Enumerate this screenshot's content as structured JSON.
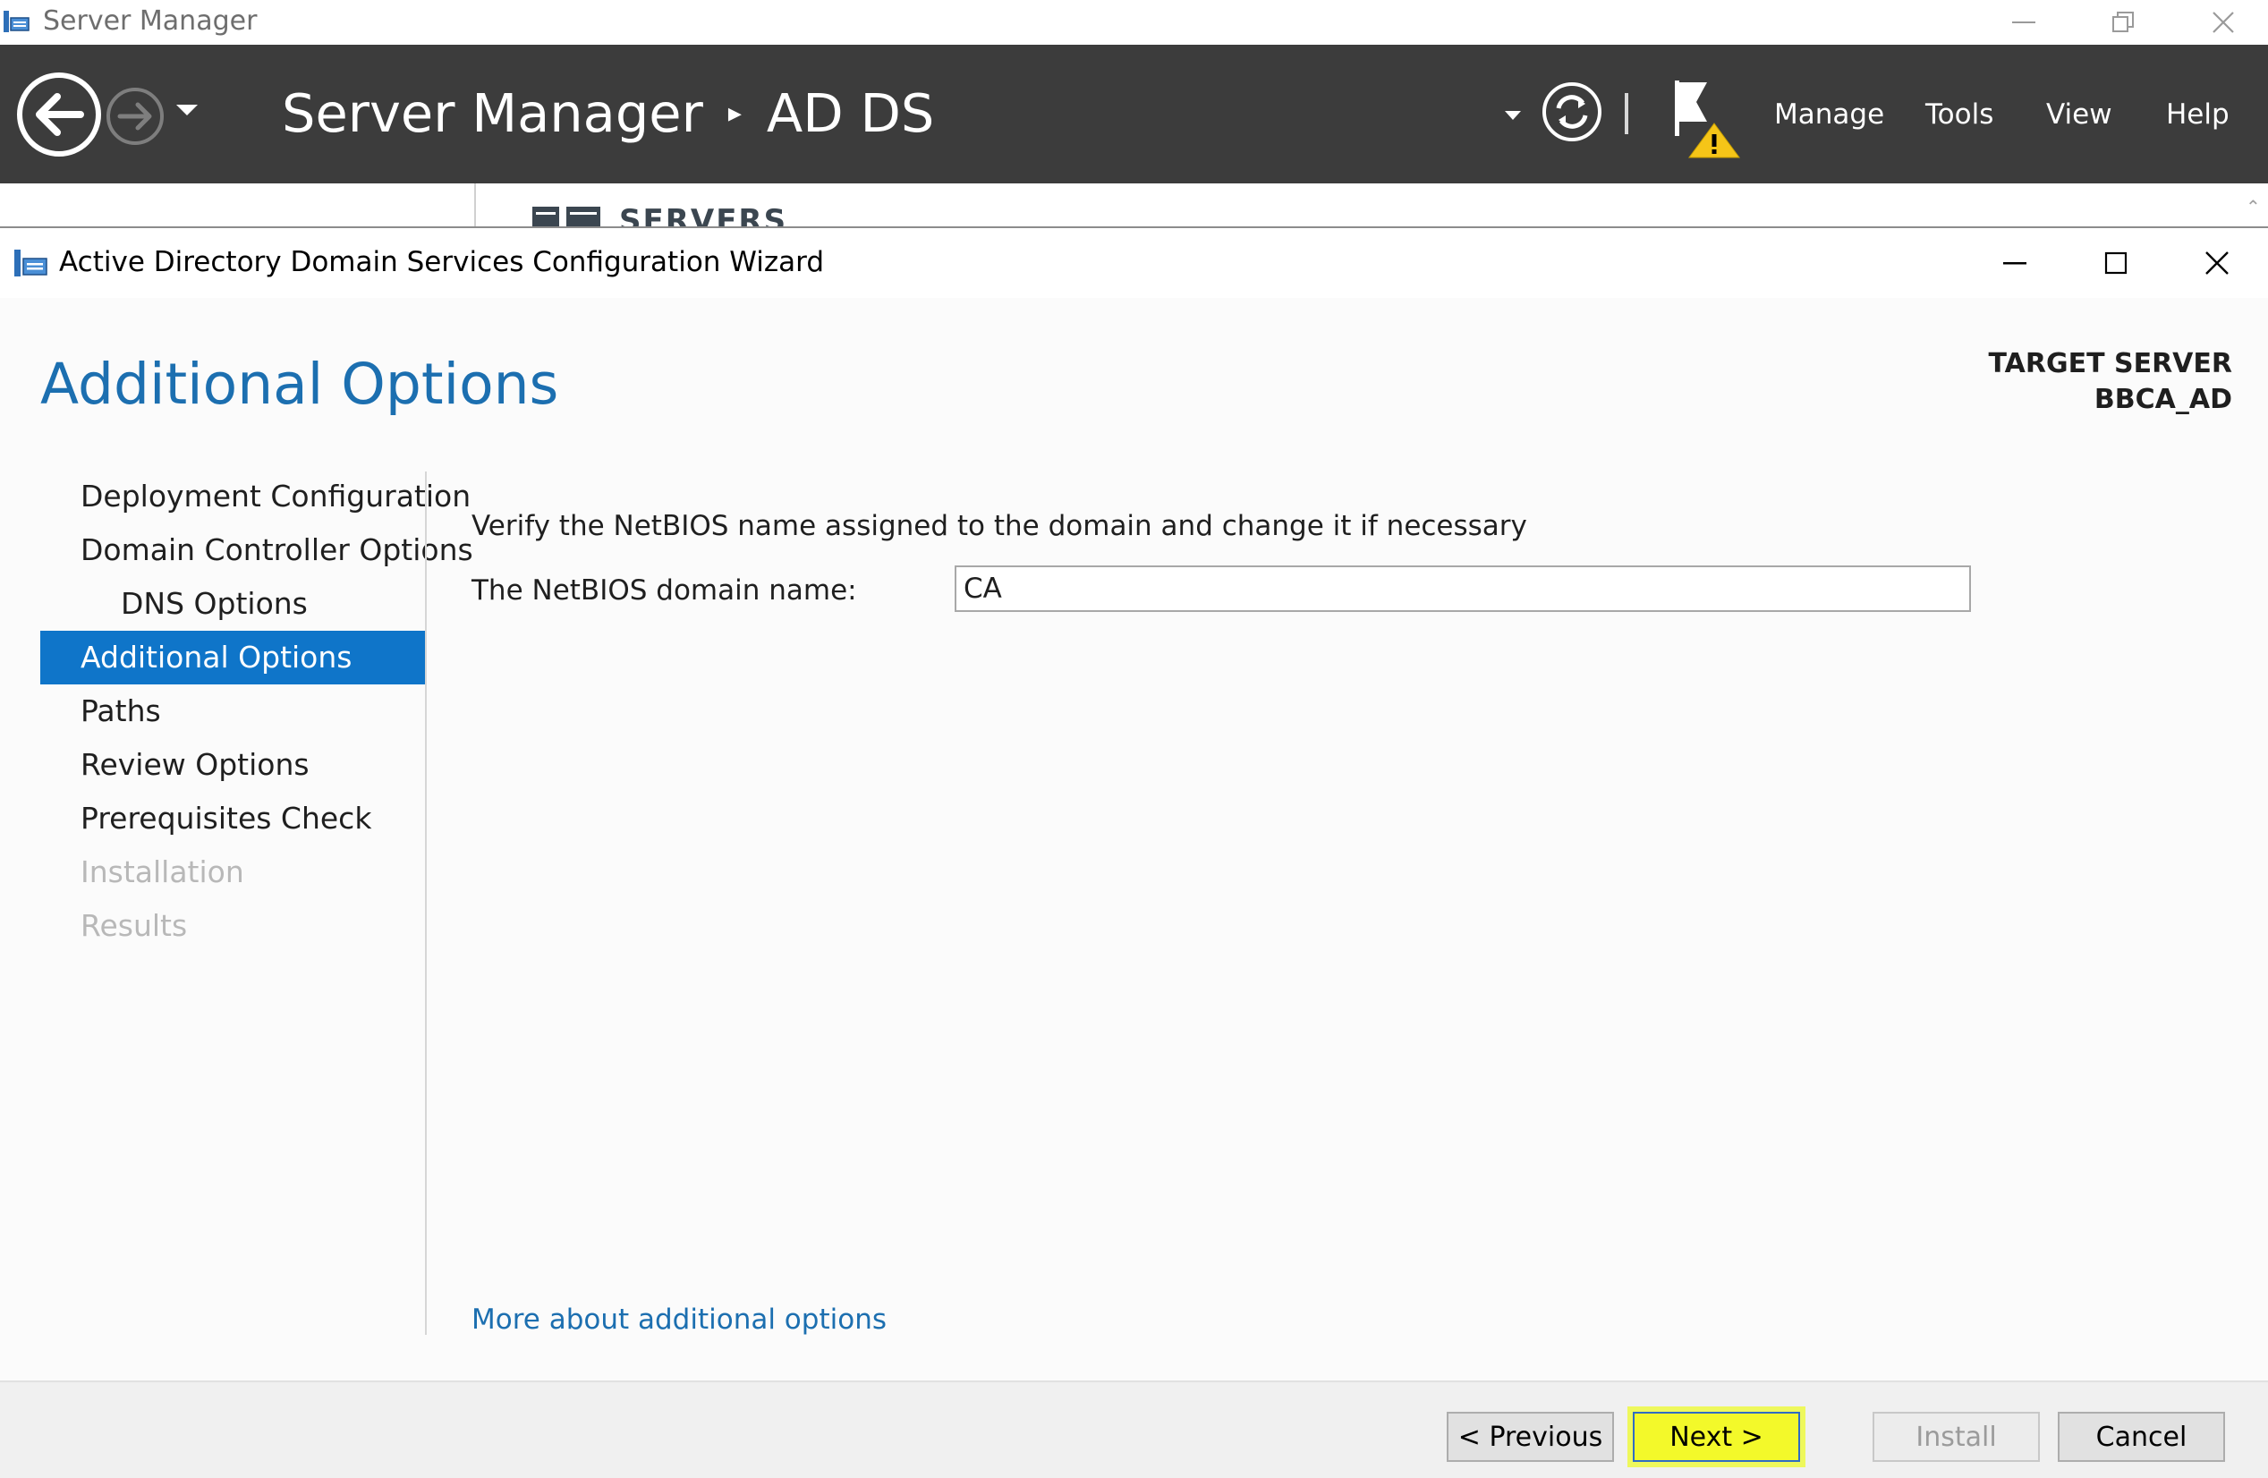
{
  "server_manager": {
    "window_title": "Server Manager",
    "breadcrumb": {
      "root": "Server Manager",
      "separator": "▸",
      "current": "AD DS"
    },
    "menu": {
      "manage": "Manage",
      "tools": "Tools",
      "view": "View",
      "help": "Help"
    },
    "servers_section_label": "SERVERS"
  },
  "wizard": {
    "window_title": "Active Directory Domain Services Configuration Wizard",
    "page_title": "Additional Options",
    "target_server": {
      "label": "TARGET SERVER",
      "name": "BBCA_AD"
    },
    "steps": [
      {
        "label": "Deployment Configuration",
        "state": "normal"
      },
      {
        "label": "Domain Controller Options",
        "state": "normal"
      },
      {
        "label": "DNS Options",
        "state": "normal"
      },
      {
        "label": "Additional Options",
        "state": "selected"
      },
      {
        "label": "Paths",
        "state": "normal"
      },
      {
        "label": "Review Options",
        "state": "normal"
      },
      {
        "label": "Prerequisites Check",
        "state": "normal"
      },
      {
        "label": "Installation",
        "state": "disabled"
      },
      {
        "label": "Results",
        "state": "disabled"
      }
    ],
    "instruction": "Verify the NetBIOS name assigned to the domain and change it if necessary",
    "netbios_label": "The NetBIOS domain name:",
    "netbios_value": "CA",
    "more_link": "More about additional options",
    "buttons": {
      "previous": "< Previous",
      "next": "Next >",
      "install": "Install",
      "cancel": "Cancel"
    }
  },
  "colors": {
    "header_bg": "#3c3c3c",
    "accent_blue": "#1c6fb0",
    "selected_step_bg": "#0f75c9",
    "next_highlight": "#f3f92a",
    "warning_yellow": "#f5c518"
  },
  "icons": {
    "back": "back-arrow-icon",
    "forward": "forward-arrow-icon",
    "refresh": "refresh-icon",
    "notifications": "flag-warning-icon"
  }
}
